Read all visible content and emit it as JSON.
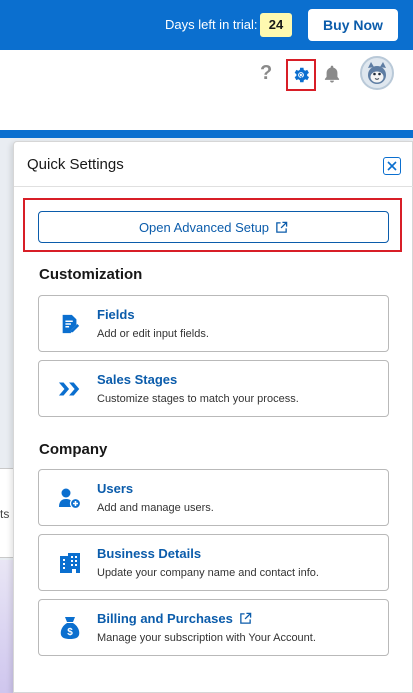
{
  "topbar": {
    "trial_label": "Days left in trial:",
    "trial_days": "24",
    "buy_label": "Buy Now",
    "color": "#0b6fcf"
  },
  "header": {
    "help_glyph": "?",
    "icons": [
      "help-icon",
      "gear-icon",
      "bell-icon",
      "avatar"
    ]
  },
  "background": {
    "partial_text": "ts"
  },
  "panel": {
    "title": "Quick Settings",
    "advanced_setup_label": "Open Advanced Setup",
    "sections": [
      {
        "heading": "Customization",
        "items": [
          {
            "title": "Fields",
            "description": "Add or edit input fields.",
            "icon": "fields-icon"
          },
          {
            "title": "Sales Stages",
            "description": "Customize stages to match your process.",
            "icon": "chevrons-icon"
          }
        ]
      },
      {
        "heading": "Company",
        "items": [
          {
            "title": "Users",
            "description": "Add and manage users.",
            "icon": "user-add-icon"
          },
          {
            "title": "Business Details",
            "description": "Update your company name and contact info.",
            "icon": "building-icon"
          },
          {
            "title": "Billing and Purchases",
            "description": "Manage your subscription with Your Account.",
            "icon": "money-bag-icon"
          }
        ]
      }
    ]
  },
  "colors": {
    "accent": "#0b5cab",
    "highlight": "#d81e27",
    "trial_badge": "#fef9b0"
  }
}
